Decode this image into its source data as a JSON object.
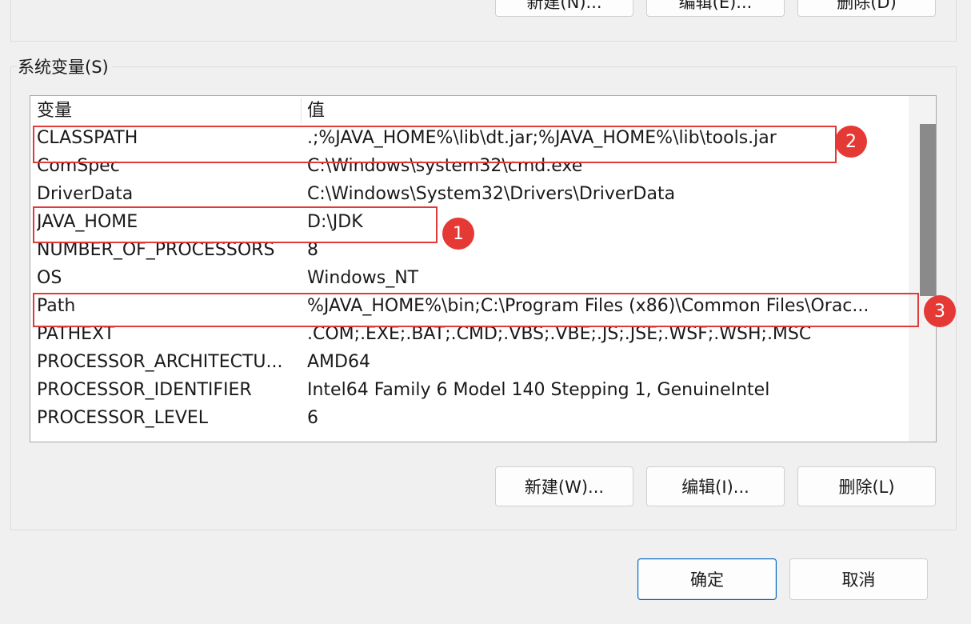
{
  "top_buttons": {
    "new": "新建(N)...",
    "edit": "编辑(E)...",
    "delete": "删除(D)"
  },
  "system_variables": {
    "group_title": "系统变量(S)",
    "columns": [
      "变量",
      "值"
    ],
    "rows": [
      {
        "name": "CLASSPATH",
        "value": ".;%JAVA_HOME%\\lib\\dt.jar;%JAVA_HOME%\\lib\\tools.jar"
      },
      {
        "name": "ComSpec",
        "value": "C:\\Windows\\system32\\cmd.exe"
      },
      {
        "name": "DriverData",
        "value": "C:\\Windows\\System32\\Drivers\\DriverData"
      },
      {
        "name": "JAVA_HOME",
        "value": "D:\\JDK"
      },
      {
        "name": "NUMBER_OF_PROCESSORS",
        "value": "8"
      },
      {
        "name": "OS",
        "value": "Windows_NT"
      },
      {
        "name": "Path",
        "value": "%JAVA_HOME%\\bin;C:\\Program Files (x86)\\Common Files\\Orac..."
      },
      {
        "name": "PATHEXT",
        "value": ".COM;.EXE;.BAT;.CMD;.VBS;.VBE;.JS;.JSE;.WSF;.WSH;.MSC"
      },
      {
        "name": "PROCESSOR_ARCHITECTU...",
        "value": "AMD64"
      },
      {
        "name": "PROCESSOR_IDENTIFIER",
        "value": "Intel64 Family 6 Model 140 Stepping 1, GenuineIntel"
      },
      {
        "name": "PROCESSOR_LEVEL",
        "value": "6"
      }
    ],
    "buttons": {
      "new": "新建(W)...",
      "edit": "编辑(I)...",
      "delete": "删除(L)"
    }
  },
  "annotations": [
    "1",
    "2",
    "3"
  ],
  "dialog_buttons": {
    "ok": "确定",
    "cancel": "取消"
  },
  "colors": {
    "annotation_red": "#e53935",
    "primary_border": "#0067c0"
  }
}
